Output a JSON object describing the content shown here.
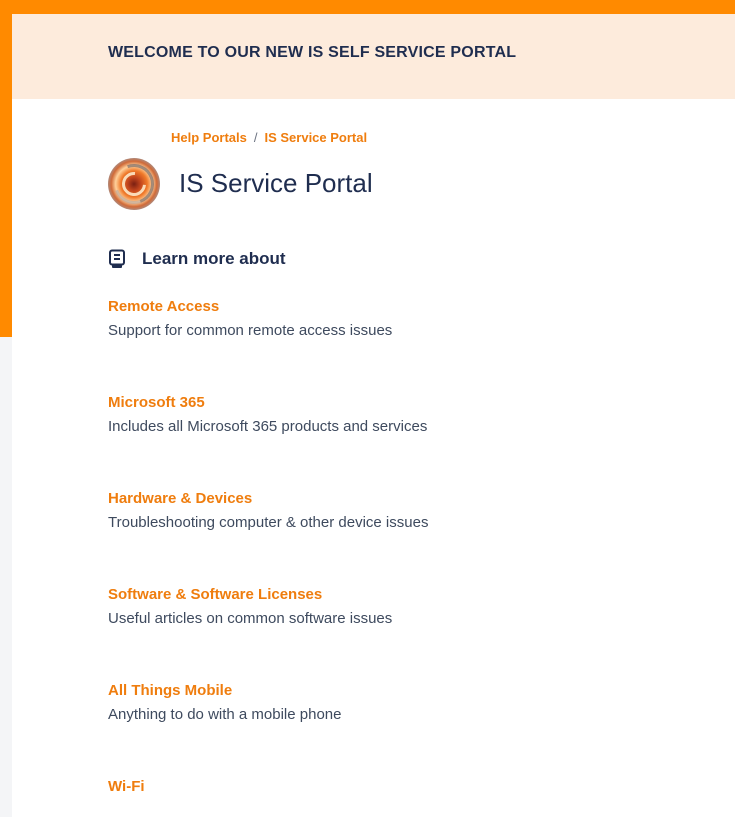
{
  "banner": {
    "text": "WELCOME TO OUR NEW IS SELF SERVICE PORTAL"
  },
  "breadcrumb": {
    "items": [
      "Help Portals",
      "IS Service Portal"
    ],
    "separator": "/"
  },
  "portal": {
    "title": "IS Service Portal",
    "logo_icon": "swirl-logo"
  },
  "learn_more": {
    "icon": "book-icon",
    "title": "Learn more about"
  },
  "topics": [
    {
      "title": "Remote Access",
      "description": "Support for common remote access issues"
    },
    {
      "title": "Microsoft 365",
      "description": "Includes all Microsoft 365 products and services"
    },
    {
      "title": "Hardware & Devices",
      "description": "Troubleshooting computer & other device issues"
    },
    {
      "title": "Software & Software Licenses",
      "description": "Useful articles on common software issues"
    },
    {
      "title": "All Things Mobile",
      "description": "Anything to do with a mobile phone"
    },
    {
      "title": "Wi-Fi",
      "description": ""
    }
  ],
  "colors": {
    "accent": "#ff8a00",
    "link": "#ef7d0e",
    "heading": "#1f2d4f",
    "banner_bg": "#fdebdc"
  }
}
